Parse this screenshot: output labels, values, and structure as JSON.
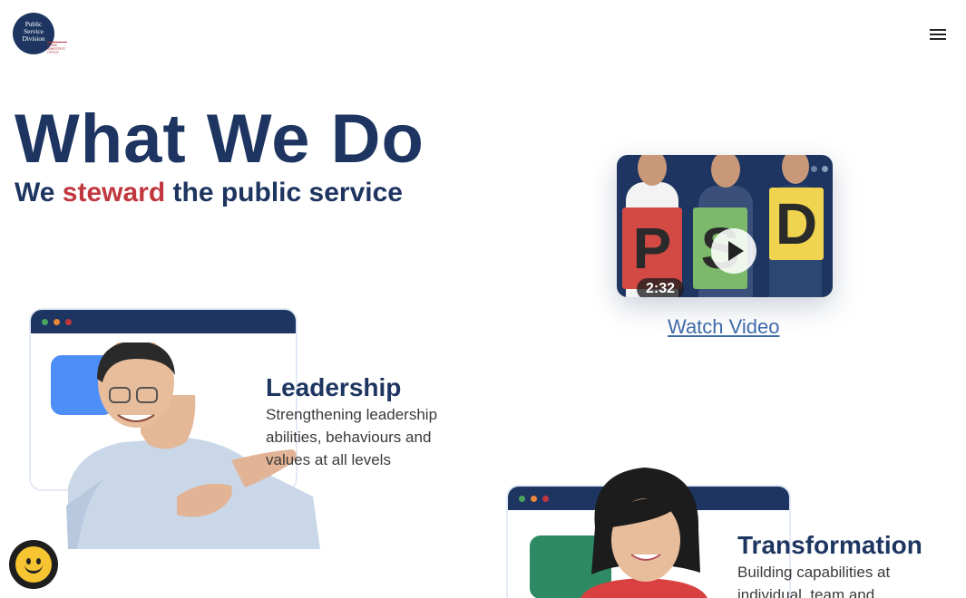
{
  "logo": {
    "line1": "Public",
    "line2": "Service",
    "line3": "Division",
    "tagline": "PRIME MINISTER'S OFFICE"
  },
  "header": {
    "menu_icon": "hamburger-menu-icon"
  },
  "hero": {
    "title": "What We Do",
    "subtitle_pre": "We ",
    "subtitle_accent": "steward",
    "subtitle_post": " the public service"
  },
  "video": {
    "letters": [
      "P",
      "S",
      "D"
    ],
    "duration": "2:32",
    "link_label": "Watch Video"
  },
  "features": [
    {
      "title": "Leadership",
      "description": "Strengthening leadership abilities, behaviours and values at all levels"
    },
    {
      "title": "Transformation",
      "description": "Building capabilities at individual, team and"
    }
  ],
  "feedback": {
    "icon": "smiley-face-icon"
  },
  "colors": {
    "navy": "#1d3560",
    "accent_red": "#c0383e",
    "link_blue": "#3f6aa8",
    "card_block_blue": "#4d8ef7",
    "card_block_green": "#2e8a64"
  }
}
